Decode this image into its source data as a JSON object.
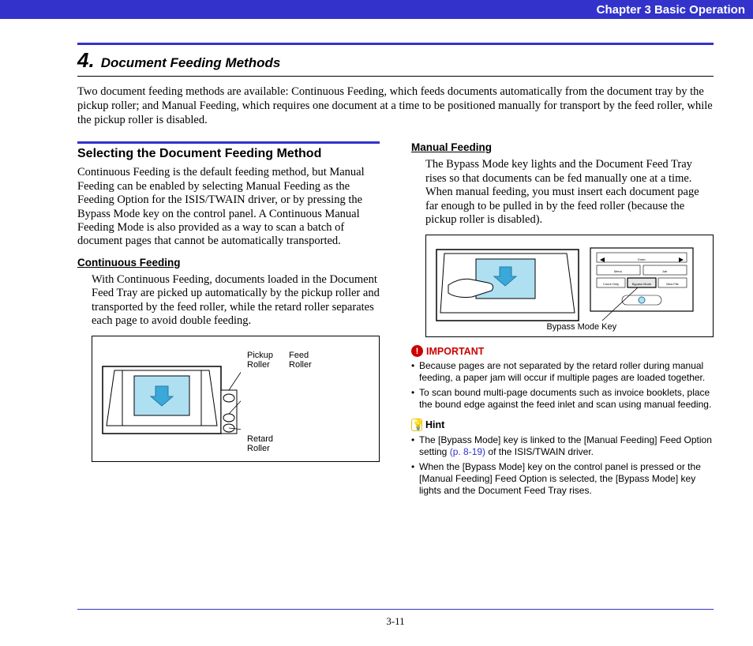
{
  "header": {
    "chapter": "Chapter 3   Basic Operation"
  },
  "section": {
    "number": "4.",
    "title": "Document Feeding Methods"
  },
  "intro": "Two document feeding methods are available: Continuous Feeding, which feeds documents automatically from the document tray by the pickup roller; and Manual Feeding, which requires one document at a time to be positioned manually for transport by the feed roller, while the pickup roller is disabled.",
  "left": {
    "heading": "Selecting the Document Feeding Method",
    "p1": "Continuous Feeding is the default feeding method, but Manual Feeding can be enabled by selecting Manual Feeding as the Feeding Option for the ISIS/TWAIN driver, or by pressing the Bypass Mode key on the control panel. A Continuous Manual Feeding Mode is also provided as a way to scan a batch of document pages that cannot be automatically transported.",
    "sub1": "Continuous Feeding",
    "p2": "With Continuous Feeding, documents loaded in the Document Feed Tray are picked up automatically by the pickup roller and transported by the feed roller, while the retard roller separates each page to avoid double feeding.",
    "fig1": {
      "pickup": "Pickup\nRoller",
      "feed": "Feed\nRoller",
      "retard": "Retard\nRoller"
    }
  },
  "right": {
    "sub1": "Manual Feeding",
    "p1": "The Bypass Mode key lights and the Document Feed Tray rises so that documents can be fed manually one at a time. When manual feeding, you must insert each document page far enough to be pulled in by the feed roller (because the pickup roller is disabled).",
    "fig2": {
      "bypass": "Bypass Mode Key",
      "panel": {
        "enter": "Enter",
        "menu": "Menu",
        "job": "Job",
        "countonly": "Count Only",
        "bypassmode": "Bypass Mode",
        "newfile": "New File"
      }
    },
    "important": {
      "label": "IMPORTANT",
      "items": [
        "Because pages are not separated by the retard roller during manual feeding, a paper jam will occur if multiple pages are loaded together.",
        "To scan bound multi-page documents such as invoice booklets, place the bound edge against the feed inlet and scan using manual feeding."
      ]
    },
    "hint": {
      "label": "Hint",
      "items": [
        {
          "pre": "The [Bypass Mode] key is linked to the [Manual Feeding] Feed Option setting ",
          "link": "(p. 8-19)",
          "post": " of the ISIS/TWAIN driver."
        },
        {
          "pre": "When the [Bypass Mode] key on the control panel is pressed or the [Manual Feeding] Feed Option is selected, the [Bypass Mode] key lights and the Document Feed Tray rises.",
          "link": "",
          "post": ""
        }
      ]
    }
  },
  "footer": {
    "page": "3-11"
  }
}
